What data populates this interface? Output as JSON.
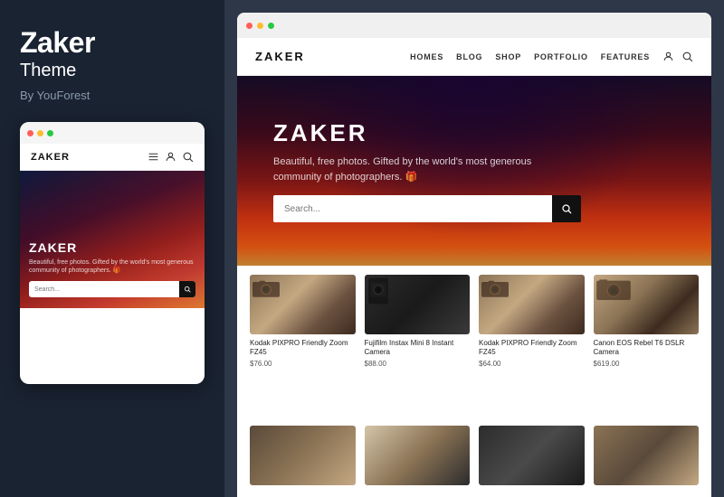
{
  "left": {
    "title": "Zaker",
    "theme_label": "Theme",
    "author": "By YouForest",
    "mobile_logo": "ZAKER",
    "mobile_hero_title": "ZAKER",
    "mobile_hero_text": "Beautiful, free photos. Gifted by the world's most generous community of photographers. 🎁",
    "mobile_search_placeholder": "Search..."
  },
  "right": {
    "desktop_logo": "ZAKER",
    "nav_links": [
      "HOMES",
      "BLOG",
      "SHOP",
      "PORTFOLIO",
      "FEATURES"
    ],
    "hero_title": "ZAKER",
    "hero_text": "Beautiful, free photos. Gifted by the world's most generous community of photographers. 🎁",
    "search_placeholder": "Search...",
    "products": [
      {
        "name": "Kodak PIXPRO Friendly Zoom FZ45",
        "price": "$76.00"
      },
      {
        "name": "Fujifilm Instax Mini 8 Instant Camera",
        "price": "$88.00"
      },
      {
        "name": "Kodak PIXPRO Friendly Zoom FZ45",
        "price": "$64.00"
      },
      {
        "name": "Canon EOS Rebel T6 DSLR Camera",
        "price": "$619.00"
      }
    ]
  }
}
